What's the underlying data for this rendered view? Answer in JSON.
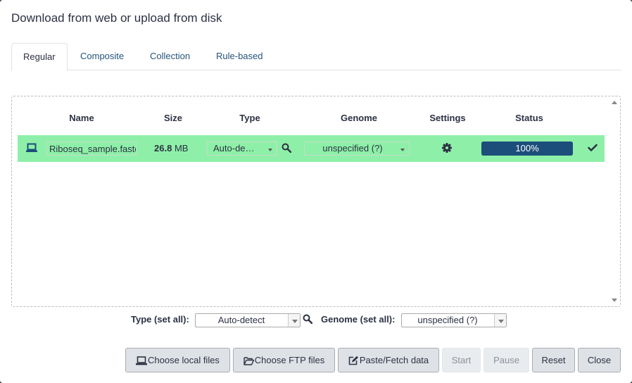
{
  "modal": {
    "title": "Download from web or upload from disk"
  },
  "tabs": [
    {
      "label": "Regular",
      "active": true
    },
    {
      "label": "Composite",
      "active": false
    },
    {
      "label": "Collection",
      "active": false
    },
    {
      "label": "Rule-based",
      "active": false
    }
  ],
  "table": {
    "headers": {
      "name": "Name",
      "size": "Size",
      "type": "Type",
      "genome": "Genome",
      "settings": "Settings",
      "status": "Status"
    },
    "rows": [
      {
        "name": "Riboseq_sample.fastq",
        "size_value": "26.8",
        "size_unit": "MB",
        "type": "Auto-de…",
        "genome": "unspecified (?)",
        "progress": 100,
        "progress_label": "100%"
      }
    ]
  },
  "set_all": {
    "type_label": "Type (set all):",
    "type_value": "Auto-detect",
    "genome_label": "Genome (set all):",
    "genome_value": "unspecified (?)"
  },
  "buttons": {
    "choose_local": "Choose local files",
    "choose_ftp": "Choose FTP files",
    "paste_fetch": "Paste/Fetch data",
    "start": "Start",
    "pause": "Pause",
    "reset": "Reset",
    "close": "Close"
  },
  "colors": {
    "row_success": "#8ef0a8",
    "progress_bar": "#1c4e7b",
    "link": "#25537b"
  },
  "icons": [
    "laptop-icon",
    "search-icon",
    "gear-icon",
    "check-icon",
    "folder-open-icon",
    "edit-icon"
  ]
}
